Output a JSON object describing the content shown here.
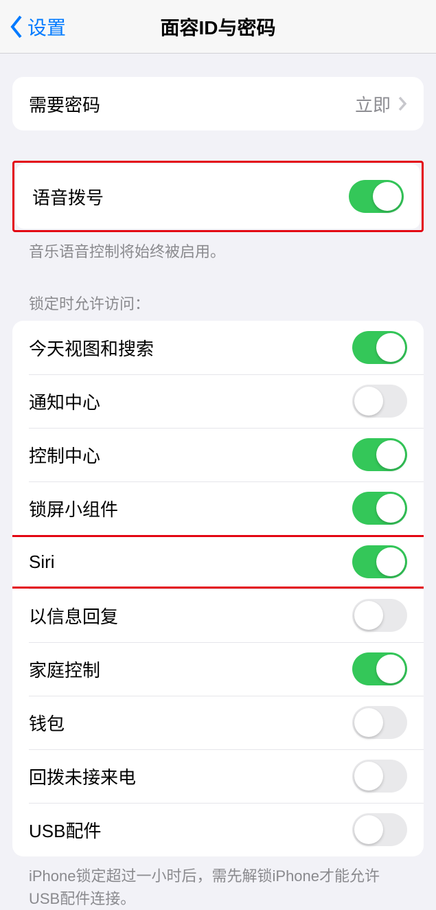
{
  "nav": {
    "back_label": "设置",
    "title": "面容ID与密码"
  },
  "require_passcode": {
    "label": "需要密码",
    "value": "立即"
  },
  "voice_dial": {
    "label": "语音拨号",
    "footer": "音乐语音控制将始终被启用。",
    "on": true
  },
  "lock_access": {
    "header": "锁定时允许访问：",
    "items": [
      {
        "label": "今天视图和搜索",
        "on": true
      },
      {
        "label": "通知中心",
        "on": false
      },
      {
        "label": "控制中心",
        "on": true
      },
      {
        "label": "锁屏小组件",
        "on": true
      },
      {
        "label": "Siri",
        "on": true
      },
      {
        "label": "以信息回复",
        "on": false
      },
      {
        "label": "家庭控制",
        "on": true
      },
      {
        "label": "钱包",
        "on": false
      },
      {
        "label": "回拨未接来电",
        "on": false
      },
      {
        "label": "USB配件",
        "on": false
      }
    ],
    "footer": "iPhone锁定超过一小时后，需先解锁iPhone才能允许USB配件连接。"
  }
}
